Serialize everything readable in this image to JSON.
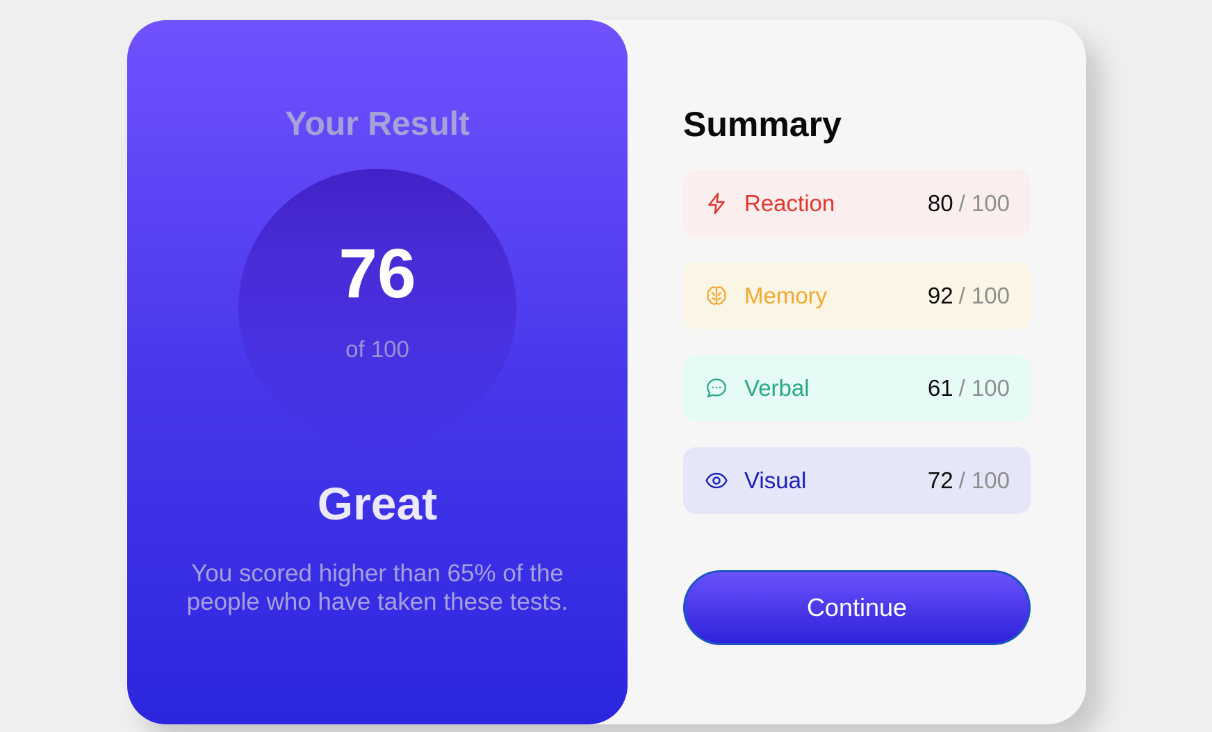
{
  "result": {
    "title": "Your Result",
    "score": "76",
    "score_max": "of 100",
    "rating": "Great",
    "description": "You scored higher than 65% of the people who have taken these tests."
  },
  "summary": {
    "title": "Summary",
    "items": [
      {
        "label": "Reaction",
        "score": "80",
        "total": "/ 100",
        "icon": "lightning-icon",
        "color": "#e1372d",
        "bg": "#fbeeee"
      },
      {
        "label": "Memory",
        "score": "92",
        "total": "/ 100",
        "icon": "brain-icon",
        "color": "#f2a92e",
        "bg": "#fbf5e6"
      },
      {
        "label": "Verbal",
        "score": "61",
        "total": "/ 100",
        "icon": "chat-bubble-icon",
        "color": "#2aa882",
        "bg": "#e6fbf5"
      },
      {
        "label": "Visual",
        "score": "72",
        "total": "/ 100",
        "icon": "eye-icon",
        "color": "#1a1fb8",
        "bg": "#e5e6f8"
      }
    ]
  },
  "continue_label": "Continue"
}
